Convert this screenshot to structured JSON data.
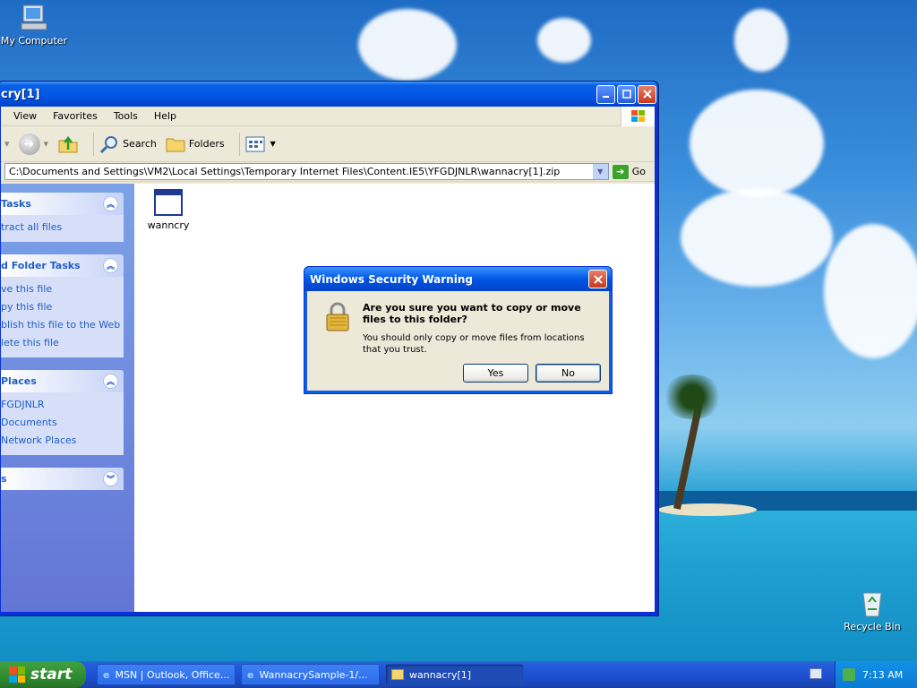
{
  "desktop": {
    "icons": [
      {
        "label": "My Computer"
      },
      {
        "label": "Recycle Bin"
      }
    ]
  },
  "window": {
    "title": "cry[1]",
    "menu": [
      "View",
      "Favorites",
      "Tools",
      "Help"
    ],
    "toolbar": {
      "search": "Search",
      "folders": "Folders"
    },
    "address": "C:\\Documents and Settings\\VM2\\Local Settings\\Temporary Internet Files\\Content.IE5\\YFGDJNLR\\wannacry[1].zip",
    "go": "Go",
    "panels": [
      {
        "title": "Tasks",
        "chev": "︽",
        "items": [
          "tract all files"
        ]
      },
      {
        "title": "d Folder Tasks",
        "chev": "︽",
        "items": [
          "ve this file",
          "py this file",
          "blish this file to the Web",
          "lete this file"
        ]
      },
      {
        "title": "Places",
        "chev": "︽",
        "items": [
          "FGDJNLR",
          "Documents",
          "Network Places"
        ]
      },
      {
        "title": "s",
        "chev": "︾",
        "items": []
      }
    ],
    "files": [
      {
        "name": "wanncry"
      }
    ]
  },
  "dialog": {
    "title": "Windows Security Warning",
    "question": "Are you sure you want to copy or move files to this folder?",
    "detail": "You should only copy or move files from locations that you trust.",
    "yes": "Yes",
    "no": "No"
  },
  "taskbar": {
    "start": "start",
    "tasks": [
      "MSN | Outlook, Office...",
      "WannacrySample-1/...",
      "wannacry[1]"
    ],
    "clock": "7:13 AM"
  },
  "colors": {
    "xp_blue": "#0055e5",
    "start_green": "#3c9b3c",
    "link": "#215dc6"
  }
}
